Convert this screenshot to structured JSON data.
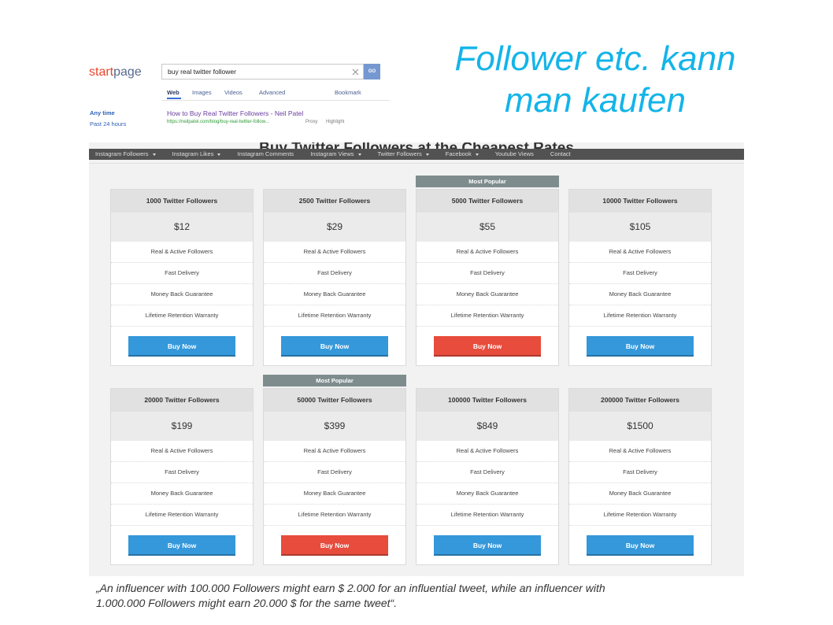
{
  "colors": {
    "title": "#14b4e9",
    "logo_start": "#e8462d",
    "logo_page": "#56698f",
    "go_button": "#7598d0",
    "nav_bg": "#525252",
    "popular_bg": "#7f8c8d",
    "buy_blue": "#3498db",
    "buy_red": "#e74c3c"
  },
  "slide": {
    "title_line1": "Follower etc. kann",
    "title_line2": "man kaufen",
    "quote_line1": "„An influencer with 100.000 Followers might earn $ 2.000 for an influential tweet, while an influencer with",
    "quote_line2": "1.000.000 Followers might earn 20.000 $ for the same tweet“."
  },
  "search": {
    "logo_start": "start",
    "logo_page": "page",
    "query": "buy real twitter follower",
    "clear_icon": "close-icon",
    "go_label": "GO",
    "tabs": [
      {
        "label": "Web",
        "active": true
      },
      {
        "label": "Images",
        "active": false
      },
      {
        "label": "Videos",
        "active": false
      },
      {
        "label": "Advanced",
        "active": false
      }
    ],
    "bookmark_label": "Bookmark",
    "filters": [
      "Any time",
      "Past 24 hours"
    ],
    "result": {
      "title": "How to Buy Real Twitter Followers - Neil Patel",
      "url": "https://neilpatel.com/blog/buy-real-twitter-follow...",
      "proxy_label": "Proxy",
      "highlight_label": "Highlight"
    }
  },
  "pricing": {
    "heading": "Buy Twitter Followers at the Cheapest Rates",
    "dropdown_icon": "caret-down-icon",
    "nav": [
      {
        "label": "Instagram Followers",
        "dropdown": true
      },
      {
        "label": "Instagram Likes",
        "dropdown": true
      },
      {
        "label": "Instagram Comments",
        "dropdown": false
      },
      {
        "label": "Instagram Views",
        "dropdown": true
      },
      {
        "label": "Twitter Followers",
        "dropdown": true
      },
      {
        "label": "Facebook",
        "dropdown": true
      },
      {
        "label": "Youtube Views",
        "dropdown": false
      },
      {
        "label": "Contact",
        "dropdown": false
      }
    ],
    "popular_label": "Most Popular",
    "buy_label": "Buy Now",
    "features": [
      "Real & Active Followers",
      "Fast Delivery",
      "Money Back Guarantee",
      "Lifetime Retention Warranty"
    ],
    "plans": [
      {
        "title": "1000 Twitter Followers",
        "price": "$12",
        "popular": false,
        "button": "blue"
      },
      {
        "title": "2500 Twitter Followers",
        "price": "$29",
        "popular": false,
        "button": "blue"
      },
      {
        "title": "5000 Twitter Followers",
        "price": "$55",
        "popular": true,
        "button": "red"
      },
      {
        "title": "10000 Twitter Followers",
        "price": "$105",
        "popular": false,
        "button": "blue"
      },
      {
        "title": "20000 Twitter Followers",
        "price": "$199",
        "popular": false,
        "button": "blue"
      },
      {
        "title": "50000 Twitter Followers",
        "price": "$399",
        "popular": true,
        "button": "red"
      },
      {
        "title": "100000 Twitter Followers",
        "price": "$849",
        "popular": false,
        "button": "blue"
      },
      {
        "title": "200000 Twitter Followers",
        "price": "$1500",
        "popular": false,
        "button": "blue"
      }
    ]
  }
}
